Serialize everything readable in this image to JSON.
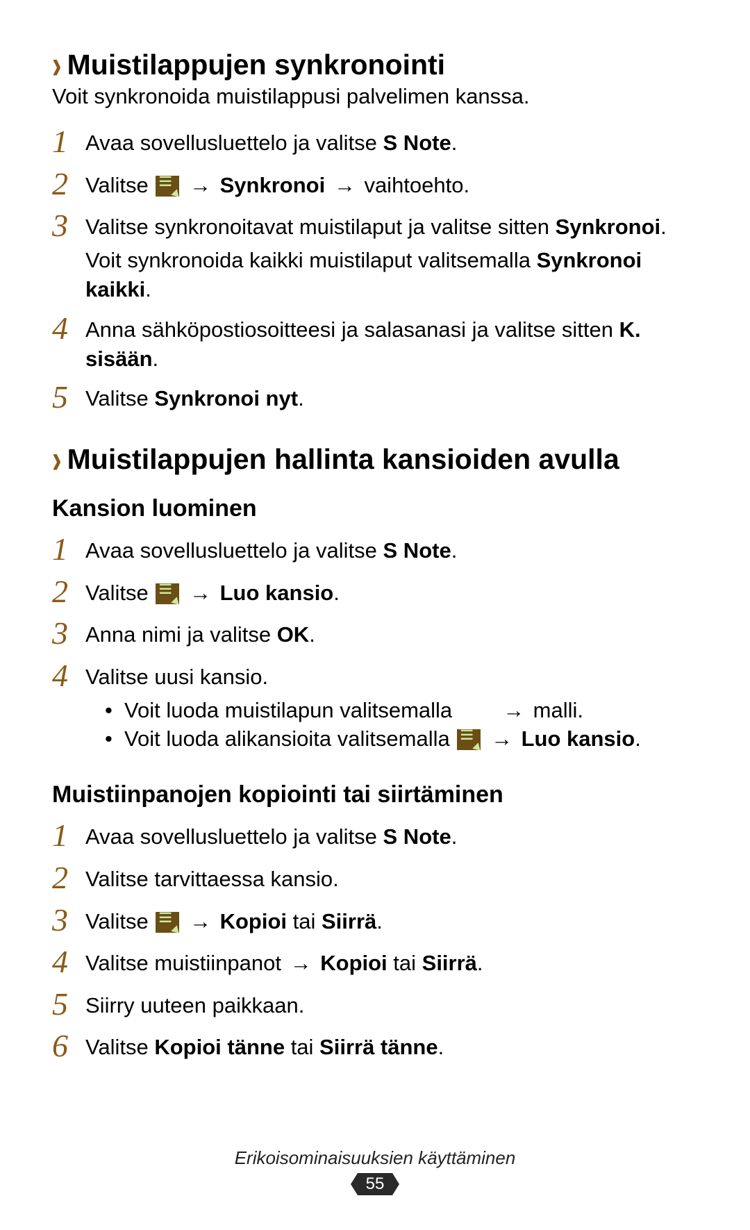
{
  "section1": {
    "title": "Muistilappujen synkronointi",
    "intro": "Voit synkronoida muistilappusi palvelimen kanssa.",
    "step1_a": "Avaa sovellusluettelo ja valitse ",
    "step1_b": "S Note",
    "step1_c": ".",
    "step2_a": "Valitse ",
    "step2_arrow1": "→",
    "step2_b": "Synkronoi",
    "step2_arrow2": "→",
    "step2_c": " vaihtoehto.",
    "step3_a": "Valitse synkronoitavat muistilaput ja valitse sitten ",
    "step3_b": "Synkronoi",
    "step3_c": ".",
    "step3_d": "Voit synkronoida kaikki muistilaput valitsemalla ",
    "step3_e": "Synkronoi kaikki",
    "step3_f": ".",
    "step4_a": "Anna sähköpostiosoitteesi ja salasanasi ja valitse sitten ",
    "step4_b": "K. sisään",
    "step4_c": ".",
    "step5_a": "Valitse ",
    "step5_b": "Synkronoi nyt",
    "step5_c": "."
  },
  "section2": {
    "title": "Muistilappujen hallinta kansioiden avulla",
    "sub1_title": "Kansion luominen",
    "s1_1a": "Avaa sovellusluettelo ja valitse ",
    "s1_1b": "S Note",
    "s1_1c": ".",
    "s1_2a": "Valitse ",
    "s1_2arrow": "→",
    "s1_2b": "Luo kansio",
    "s1_2c": ".",
    "s1_3a": "Anna nimi ja valitse ",
    "s1_3b": "OK",
    "s1_3c": ".",
    "s1_4a": "Valitse uusi kansio.",
    "s1_b1a": "Voit luoda muistilapun valitsemalla ",
    "s1_b1arrow": "→",
    "s1_b1b": " malli.",
    "s1_b2a": "Voit luoda alikansioita valitsemalla ",
    "s1_b2arrow": "→",
    "s1_b2b": "Luo kansio",
    "s1_b2c": ".",
    "sub2_title": "Muistiinpanojen kopiointi tai siirtäminen",
    "s2_1a": "Avaa sovellusluettelo ja valitse ",
    "s2_1b": "S Note",
    "s2_1c": ".",
    "s2_2a": "Valitse tarvittaessa kansio.",
    "s2_3a": "Valitse ",
    "s2_3arrow": "→",
    "s2_3b": "Kopioi",
    "s2_3c": " tai ",
    "s2_3d": "Siirrä",
    "s2_3e": ".",
    "s2_4a": "Valitse muistiinpanot ",
    "s2_4arrow": "→",
    "s2_4b": "Kopioi",
    "s2_4c": " tai ",
    "s2_4d": "Siirrä",
    "s2_4e": ".",
    "s2_5a": "Siirry uuteen paikkaan.",
    "s2_6a": "Valitse ",
    "s2_6b": "Kopioi tänne",
    "s2_6c": " tai ",
    "s2_6d": "Siirrä tänne",
    "s2_6e": "."
  },
  "footer": {
    "text": "Erikoisominaisuuksien käyttäminen",
    "page": "55"
  },
  "nums": {
    "n1": "1",
    "n2": "2",
    "n3": "3",
    "n4": "4",
    "n5": "5",
    "n6": "6"
  }
}
